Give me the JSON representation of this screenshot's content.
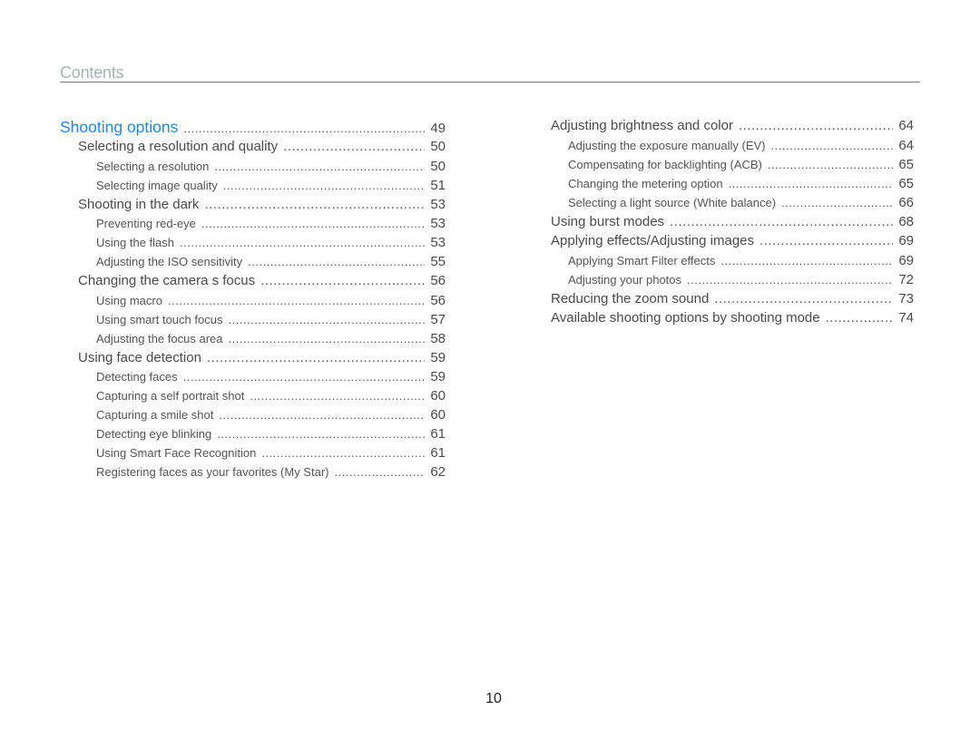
{
  "header": {
    "title": "Contents"
  },
  "toc_left": [
    {
      "level": 1,
      "label": "Shooting options",
      "page": "49"
    },
    {
      "level": 2,
      "label": "Selecting a resolution and quality",
      "page": "50"
    },
    {
      "level": 3,
      "label": "Selecting a resolution",
      "page": "50"
    },
    {
      "level": 3,
      "label": "Selecting image quality",
      "page": "51"
    },
    {
      "level": 2,
      "label": "Shooting in the dark",
      "page": "53"
    },
    {
      "level": 3,
      "label": "Preventing red-eye",
      "page": "53"
    },
    {
      "level": 3,
      "label": "Using the flash",
      "page": "53"
    },
    {
      "level": 3,
      "label": "Adjusting the ISO sensitivity",
      "page": "55"
    },
    {
      "level": 2,
      "label": "Changing the camera s focus",
      "page": "56"
    },
    {
      "level": 3,
      "label": "Using macro",
      "page": "56"
    },
    {
      "level": 3,
      "label": "Using smart touch focus",
      "page": "57"
    },
    {
      "level": 3,
      "label": "Adjusting the focus area",
      "page": "58"
    },
    {
      "level": 2,
      "label": "Using face detection",
      "page": "59"
    },
    {
      "level": 3,
      "label": "Detecting faces",
      "page": "59"
    },
    {
      "level": 3,
      "label": "Capturing a self portrait shot",
      "page": "60"
    },
    {
      "level": 3,
      "label": "Capturing a smile shot",
      "page": "60"
    },
    {
      "level": 3,
      "label": "Detecting eye blinking",
      "page": "61"
    },
    {
      "level": 3,
      "label": "Using Smart Face Recognition",
      "page": "61"
    },
    {
      "level": 3,
      "label": "Registering faces as your favorites (My Star)",
      "page": "62"
    }
  ],
  "toc_right": [
    {
      "level": 2,
      "label": "Adjusting brightness and color",
      "page": "64"
    },
    {
      "level": 3,
      "label": "Adjusting the exposure manually (EV)",
      "page": "64"
    },
    {
      "level": 3,
      "label": "Compensating for backlighting (ACB)",
      "page": "65"
    },
    {
      "level": 3,
      "label": "Changing the metering option",
      "page": "65"
    },
    {
      "level": 3,
      "label": "Selecting a light source (White balance)",
      "page": "66"
    },
    {
      "level": 2,
      "label": "Using burst modes",
      "page": "68"
    },
    {
      "level": 2,
      "label": "Applying effects/Adjusting images",
      "page": "69"
    },
    {
      "level": 3,
      "label": "Applying Smart Filter effects",
      "page": "69"
    },
    {
      "level": 3,
      "label": "Adjusting your photos",
      "page": "72"
    },
    {
      "level": 2,
      "label": "Reducing the zoom sound",
      "page": "73"
    },
    {
      "level": 2,
      "label": "Available shooting options by shooting mode",
      "page": "74"
    }
  ],
  "footer": {
    "page_number": "10"
  },
  "colors": {
    "section_heading": "#1e88f0",
    "title": "#a8b4b4",
    "text": "#4a4a4a"
  }
}
